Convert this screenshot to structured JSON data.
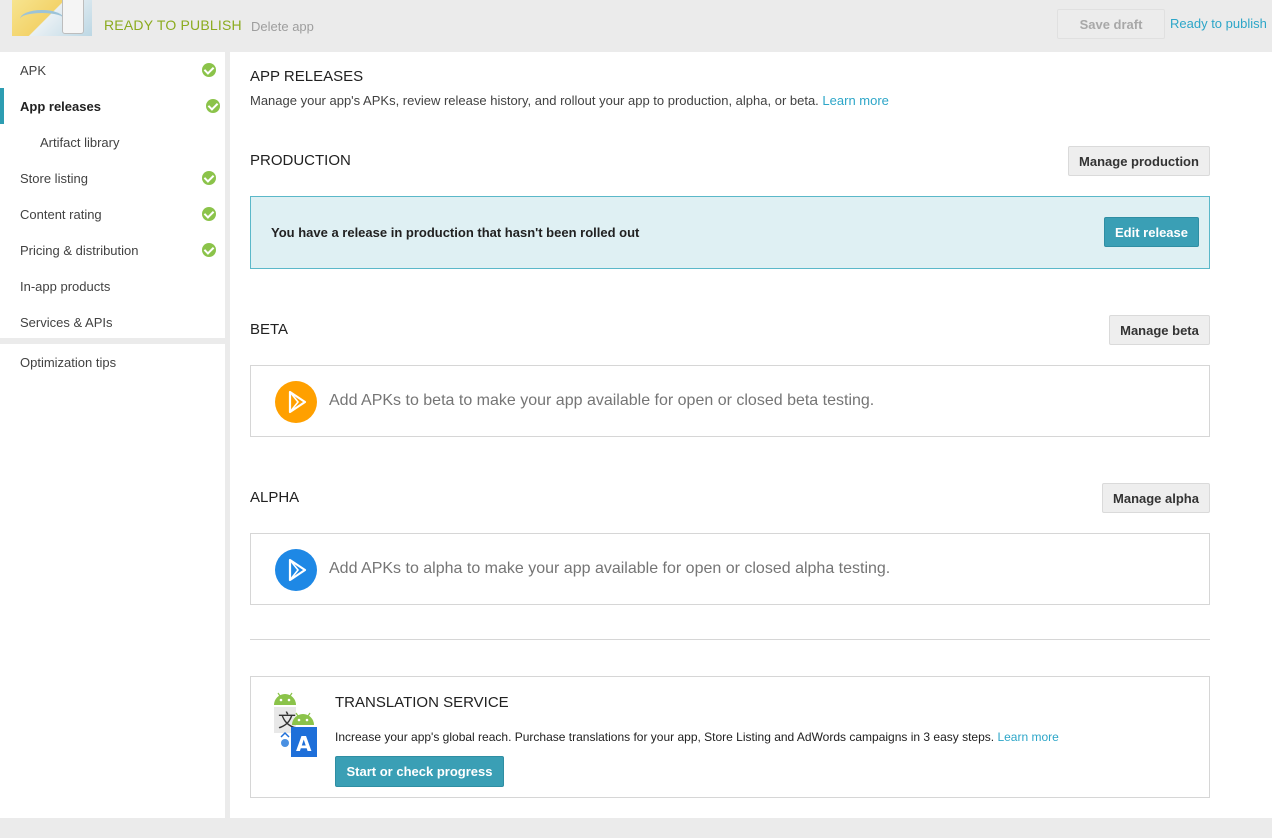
{
  "header": {
    "status": "READY TO PUBLISH",
    "delete_label": "Delete app",
    "save_draft_label": "Save draft",
    "ready_to_publish_label": "Ready to publish"
  },
  "sidebar": {
    "items": [
      {
        "label": "APK",
        "complete": true
      },
      {
        "label": "App releases",
        "complete": true,
        "active": true
      },
      {
        "label": "Artifact library",
        "complete": false
      },
      {
        "label": "Store listing",
        "complete": true
      },
      {
        "label": "Content rating",
        "complete": true
      },
      {
        "label": "Pricing & distribution",
        "complete": true
      },
      {
        "label": "In-app products",
        "complete": false
      },
      {
        "label": "Services & APIs",
        "complete": false
      }
    ],
    "secondary_items": [
      {
        "label": "Optimization tips"
      }
    ]
  },
  "main": {
    "title": "APP RELEASES",
    "description": "Manage your app's APKs, review release history, and rollout your app to production, alpha, or beta.",
    "learn_more": "Learn more",
    "production": {
      "title": "PRODUCTION",
      "manage_label": "Manage production",
      "banner_text": "You have a release in production that hasn't been rolled out",
      "edit_label": "Edit release"
    },
    "beta": {
      "title": "BETA",
      "manage_label": "Manage beta",
      "message": "Add APKs to beta to make your app available for open or closed beta testing."
    },
    "alpha": {
      "title": "ALPHA",
      "manage_label": "Manage alpha",
      "message": "Add APKs to alpha to make your app available for open or closed alpha testing."
    },
    "translation": {
      "title": "TRANSLATION SERVICE",
      "description": "Increase your app's global reach. Purchase translations for your app, Store Listing and AdWords campaigns in 3 easy steps.",
      "learn_more": "Learn more",
      "button_label": "Start or check progress"
    }
  },
  "colors": {
    "accent": "#3a9fb5",
    "link": "#2da6c8",
    "status_green": "#8bab1f",
    "check_green": "#8bc34a",
    "beta_orange": "#ffa000",
    "alpha_blue": "#1e88e5"
  }
}
